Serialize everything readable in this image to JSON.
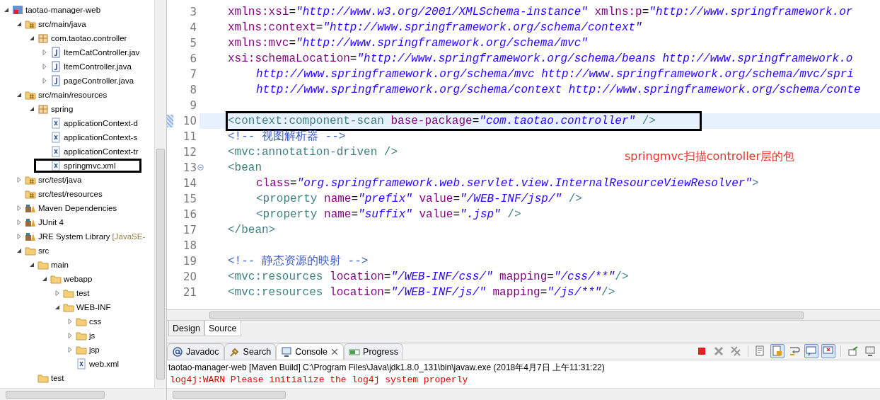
{
  "project_explorer": {
    "items": [
      {
        "label": "taotao-manager-web",
        "kind": "project",
        "expanded": true,
        "children": [
          {
            "label": "src/main/java",
            "kind": "source-folder",
            "expanded": true,
            "children": [
              {
                "label": "com.taotao.controller",
                "kind": "package",
                "expanded": true,
                "children": [
                  {
                    "label": "ItemCatController.jav",
                    "kind": "java",
                    "expanded": false
                  },
                  {
                    "label": "ItemController.java",
                    "kind": "java",
                    "expanded": false
                  },
                  {
                    "label": "pageController.java",
                    "kind": "java",
                    "expanded": false
                  }
                ]
              }
            ]
          },
          {
            "label": "src/main/resources",
            "kind": "source-folder",
            "expanded": true,
            "children": [
              {
                "label": "spring",
                "kind": "package",
                "expanded": true,
                "children": [
                  {
                    "label": "applicationContext-d",
                    "kind": "xml"
                  },
                  {
                    "label": "applicationContext-s",
                    "kind": "xml"
                  },
                  {
                    "label": "applicationContext-tr",
                    "kind": "xml"
                  },
                  {
                    "label": "springmvc.xml",
                    "kind": "xml",
                    "annotated": true
                  }
                ]
              }
            ]
          },
          {
            "label": "src/test/java",
            "kind": "source-folder",
            "expanded": false
          },
          {
            "label": "src/test/resources",
            "kind": "source-folder"
          },
          {
            "label": "Maven Dependencies",
            "kind": "library",
            "expanded": false
          },
          {
            "label": "JUnit 4",
            "kind": "library",
            "expanded": false
          },
          {
            "label": "JRE System Library",
            "suffix": "[JavaSE-",
            "kind": "library",
            "expanded": false
          },
          {
            "label": "src",
            "kind": "folder",
            "expanded": true,
            "children": [
              {
                "label": "main",
                "kind": "folder",
                "expanded": true,
                "children": [
                  {
                    "label": "webapp",
                    "kind": "folder",
                    "expanded": true,
                    "children": [
                      {
                        "label": "test",
                        "kind": "folder",
                        "expanded": false
                      },
                      {
                        "label": "WEB-INF",
                        "kind": "folder",
                        "expanded": true,
                        "children": [
                          {
                            "label": "css",
                            "kind": "folder",
                            "expanded": false
                          },
                          {
                            "label": "js",
                            "kind": "folder",
                            "expanded": false
                          },
                          {
                            "label": "jsp",
                            "kind": "folder",
                            "expanded": false
                          },
                          {
                            "label": "web.xml",
                            "kind": "xml"
                          }
                        ]
                      }
                    ]
                  }
                ]
              },
              {
                "label": "test",
                "kind": "folder"
              }
            ]
          }
        ]
      }
    ]
  },
  "editor": {
    "lines": [
      {
        "number": "3",
        "tokens": [
          {
            "kind": "attr",
            "text": "xmlns:xsi"
          },
          {
            "kind": "eq",
            "text": "="
          },
          {
            "kind": "val",
            "text": "\"http://www.w3.org/2001/XMLSchema-instance\""
          },
          {
            "kind": "attr",
            "text": " xmlns:p"
          },
          {
            "kind": "eq",
            "text": "="
          },
          {
            "kind": "val",
            "text": "\"http://www.springframework.or"
          }
        ]
      },
      {
        "number": "4",
        "tokens": [
          {
            "kind": "attr",
            "text": "xmlns:context"
          },
          {
            "kind": "eq",
            "text": "="
          },
          {
            "kind": "val",
            "text": "\"http://www.springframework.org/schema/context\""
          }
        ]
      },
      {
        "number": "5",
        "tokens": [
          {
            "kind": "attr",
            "text": "xmlns:mvc"
          },
          {
            "kind": "eq",
            "text": "="
          },
          {
            "kind": "val",
            "text": "\"http://www.springframework.org/schema/mvc\""
          }
        ]
      },
      {
        "number": "6",
        "tokens": [
          {
            "kind": "attr",
            "text": "xsi:schemaLocation"
          },
          {
            "kind": "eq",
            "text": "="
          },
          {
            "kind": "val",
            "text": "\"http://www.springframework.org/schema/beans http://www.springframework.o"
          }
        ]
      },
      {
        "number": "7",
        "nested": true,
        "tokens": [
          {
            "kind": "val",
            "text": "http://www.springframework.org/schema/mvc http://www.springframework.org/schema/mvc/spri"
          }
        ]
      },
      {
        "number": "8",
        "nested": true,
        "tokens": [
          {
            "kind": "val",
            "text": "http://www.springframework.org/schema/context http://www.springframework.org/schema/conte"
          }
        ]
      },
      {
        "number": "9"
      },
      {
        "number": "10",
        "current": true,
        "annotated": true,
        "tokens": [
          {
            "kind": "tag",
            "text": "<context:component-scan"
          },
          {
            "kind": "attr",
            "text": " base-package"
          },
          {
            "kind": "eq",
            "text": "="
          },
          {
            "kind": "val",
            "text": "\"com.taotao.controller\""
          },
          {
            "kind": "tag",
            "text": " />"
          }
        ]
      },
      {
        "number": "11",
        "tokens": [
          {
            "kind": "comment",
            "text": "<!-- 视图解析器 -->"
          }
        ]
      },
      {
        "number": "12",
        "tokens": [
          {
            "kind": "tag",
            "text": "<mvc:annotation-driven />"
          }
        ]
      },
      {
        "number": "13",
        "foldable": true,
        "tokens": [
          {
            "kind": "tag",
            "text": "<bean"
          }
        ]
      },
      {
        "number": "14",
        "nested": true,
        "tokens": [
          {
            "kind": "attr",
            "text": "class"
          },
          {
            "kind": "eq",
            "text": "="
          },
          {
            "kind": "val",
            "text": "\"org.springframework.web.servlet.view.InternalResourceViewResolver\""
          },
          {
            "kind": "tag",
            "text": ">"
          }
        ]
      },
      {
        "number": "15",
        "nested": true,
        "tokens": [
          {
            "kind": "tag",
            "text": "<property"
          },
          {
            "kind": "attr",
            "text": " name"
          },
          {
            "kind": "eq",
            "text": "="
          },
          {
            "kind": "val",
            "text": "\"prefix\""
          },
          {
            "kind": "attr",
            "text": " value"
          },
          {
            "kind": "eq",
            "text": "="
          },
          {
            "kind": "val",
            "text": "\"/WEB-INF/jsp/\""
          },
          {
            "kind": "tag",
            "text": " />"
          }
        ]
      },
      {
        "number": "16",
        "nested": true,
        "tokens": [
          {
            "kind": "tag",
            "text": "<property"
          },
          {
            "kind": "attr",
            "text": " name"
          },
          {
            "kind": "eq",
            "text": "="
          },
          {
            "kind": "val",
            "text": "\"suffix\""
          },
          {
            "kind": "attr",
            "text": " value"
          },
          {
            "kind": "eq",
            "text": "="
          },
          {
            "kind": "val",
            "text": "\".jsp\""
          },
          {
            "kind": "tag",
            "text": " />"
          }
        ]
      },
      {
        "number": "17",
        "tokens": [
          {
            "kind": "tag",
            "text": "</bean>"
          }
        ]
      },
      {
        "number": "18"
      },
      {
        "number": "19",
        "tokens": [
          {
            "kind": "comment",
            "text": "<!-- 静态资源的映射 -->"
          }
        ]
      },
      {
        "number": "20",
        "tokens": [
          {
            "kind": "tag",
            "text": "<mvc:resources"
          },
          {
            "kind": "attr",
            "text": " location"
          },
          {
            "kind": "eq",
            "text": "="
          },
          {
            "kind": "val",
            "text": "\"/WEB-INF/css/\""
          },
          {
            "kind": "attr",
            "text": " mapping"
          },
          {
            "kind": "eq",
            "text": "="
          },
          {
            "kind": "val",
            "text": "\"/css/**\""
          },
          {
            "kind": "tag",
            "text": "/>"
          }
        ]
      },
      {
        "number": "21",
        "tokens": [
          {
            "kind": "tag",
            "text": "<mvc:resources"
          },
          {
            "kind": "attr",
            "text": " location"
          },
          {
            "kind": "eq",
            "text": "="
          },
          {
            "kind": "val",
            "text": "\"/WEB-INF/js/\""
          },
          {
            "kind": "attr",
            "text": " mapping"
          },
          {
            "kind": "eq",
            "text": "="
          },
          {
            "kind": "val",
            "text": "\"/js/**\""
          },
          {
            "kind": "tag",
            "text": "/>"
          }
        ]
      }
    ],
    "annotation_note": "springmvc扫描controller层的包",
    "tabs": [
      {
        "label": "Design",
        "selected": false
      },
      {
        "label": "Source",
        "selected": true
      }
    ]
  },
  "console": {
    "tabs": [
      {
        "label": "Javadoc",
        "kind": "javadoc",
        "selected": false
      },
      {
        "label": "Search",
        "kind": "search",
        "selected": false
      },
      {
        "label": "Console",
        "kind": "console",
        "selected": true
      },
      {
        "label": "Progress",
        "kind": "progress",
        "selected": false
      }
    ],
    "toolbar": [
      {
        "kind": "stop",
        "pressed": false
      },
      {
        "kind": "remove",
        "pressed": false
      },
      {
        "kind": "remove-all",
        "pressed": false
      },
      {
        "kind": "separator"
      },
      {
        "kind": "clear",
        "pressed": false
      },
      {
        "kind": "scroll-lock",
        "pressed": true
      },
      {
        "kind": "word-wrap",
        "pressed": false
      },
      {
        "kind": "show-stdout",
        "pressed": true
      },
      {
        "kind": "show-stderr",
        "pressed": true
      },
      {
        "kind": "separator"
      },
      {
        "kind": "pin",
        "pressed": false
      },
      {
        "kind": "display",
        "pressed": false
      }
    ],
    "header": "taotao-manager-web [Maven Build] C:\\Program Files\\Java\\jdk1.8.0_131\\bin\\javaw.exe (2018年4月7日 上午11:31:22)",
    "output": [
      {
        "text": "log4j:WARN Please initialize the log4j system properly",
        "kind": "error"
      }
    ]
  }
}
